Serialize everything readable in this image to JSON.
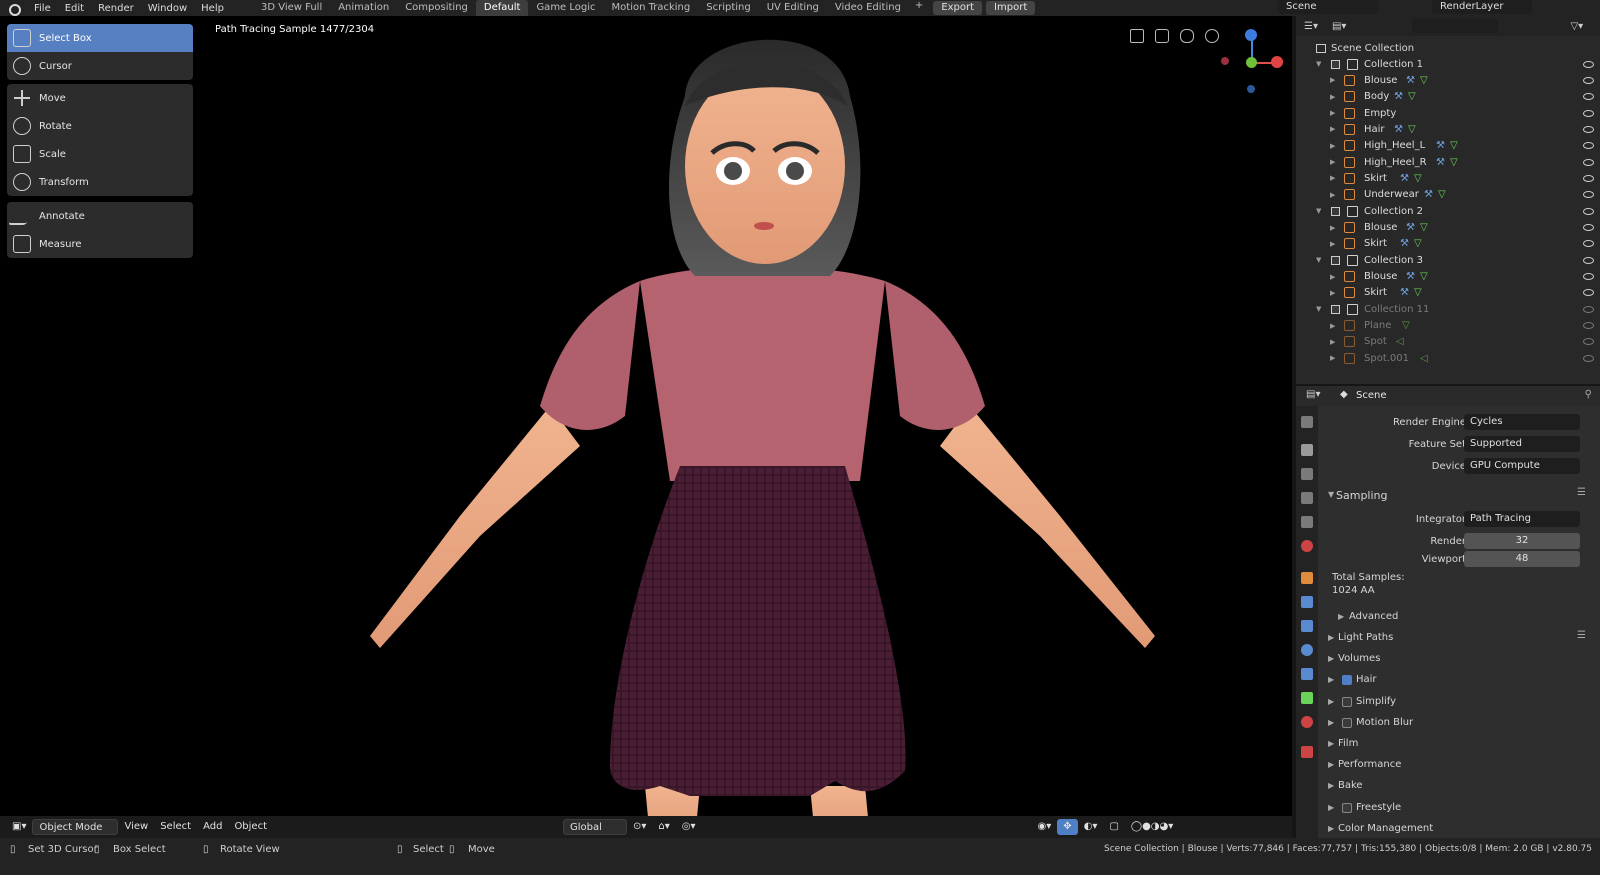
{
  "menu": [
    "File",
    "Edit",
    "Render",
    "Window",
    "Help"
  ],
  "workspace_tabs": [
    "3D View Full",
    "Animation",
    "Compositing",
    "Default",
    "Game Logic",
    "Motion Tracking",
    "Scripting",
    "UV Editing",
    "Video Editing"
  ],
  "active_tab": "Default",
  "top_buttons": {
    "export": "Export",
    "import": "Import"
  },
  "scene_name": "Scene",
  "render_layer": "RenderLayer",
  "tools": [
    {
      "label": "Select Box",
      "icon": "select-box-icon"
    },
    {
      "label": "Cursor",
      "icon": "cursor-icon"
    },
    {
      "label": "Move",
      "icon": "move-icon"
    },
    {
      "label": "Rotate",
      "icon": "rotate-icon"
    },
    {
      "label": "Scale",
      "icon": "scale-icon"
    },
    {
      "label": "Transform",
      "icon": "transform-icon"
    },
    {
      "label": "Annotate",
      "icon": "annotate-icon"
    },
    {
      "label": "Measure",
      "icon": "measure-icon"
    }
  ],
  "viewport": {
    "sample_text": "Path Tracing Sample 1477/2304"
  },
  "header": {
    "mode": "Object Mode",
    "view": "View",
    "select": "Select",
    "add": "Add",
    "object": "Object",
    "orientation": "Global"
  },
  "status": {
    "left1": "Set 3D Cursor",
    "left2": "Box Select",
    "left3": "Rotate View",
    "mid1": "Select",
    "mid2": "Move",
    "right": "Scene Collection | Blouse | Verts:77,846 | Faces:77,757 | Tris:155,380 | Objects:0/8 | Mem: 2.0 GB | v2.80.75"
  },
  "outliner": {
    "root": "Scene Collection",
    "rows": [
      {
        "label": "Collection 1",
        "kind": "collection"
      },
      {
        "label": "Blouse",
        "kind": "mesh"
      },
      {
        "label": "Body",
        "kind": "mesh"
      },
      {
        "label": "Empty",
        "kind": "empty"
      },
      {
        "label": "Hair",
        "kind": "mesh"
      },
      {
        "label": "High_Heel_L",
        "kind": "mesh"
      },
      {
        "label": "High_Heel_R",
        "kind": "mesh"
      },
      {
        "label": "Skirt",
        "kind": "mesh"
      },
      {
        "label": "Underwear",
        "kind": "mesh"
      },
      {
        "label": "Collection 2",
        "kind": "collection"
      },
      {
        "label": "Blouse",
        "kind": "mesh"
      },
      {
        "label": "Skirt",
        "kind": "mesh"
      },
      {
        "label": "Collection 3",
        "kind": "collection"
      },
      {
        "label": "Blouse",
        "kind": "mesh"
      },
      {
        "label": "Skirt",
        "kind": "mesh"
      },
      {
        "label": "Collection 11",
        "kind": "collection-dim"
      },
      {
        "label": "Plane",
        "kind": "dim"
      },
      {
        "label": "Spot",
        "kind": "dim"
      },
      {
        "label": "Spot.001",
        "kind": "dim"
      }
    ]
  },
  "properties": {
    "context": "Scene",
    "render_engine": {
      "label": "Render Engine",
      "value": "Cycles"
    },
    "feature_set": {
      "label": "Feature Set",
      "value": "Supported"
    },
    "device": {
      "label": "Device",
      "value": "GPU Compute"
    },
    "sampling": "Sampling",
    "integrator": {
      "label": "Integrator",
      "value": "Path Tracing"
    },
    "render": {
      "label": "Render",
      "value": "32"
    },
    "viewport": {
      "label": "Viewport",
      "value": "48"
    },
    "total_samples_label": "Total Samples:",
    "total_samples_value": "1024 AA",
    "advanced": "Advanced",
    "sections": [
      {
        "label": "Light Paths",
        "check": null
      },
      {
        "label": "Volumes",
        "check": null
      },
      {
        "label": "Hair",
        "check": true
      },
      {
        "label": "Simplify",
        "check": false
      },
      {
        "label": "Motion Blur",
        "check": false
      },
      {
        "label": "Film",
        "check": null
      },
      {
        "label": "Performance",
        "check": null
      },
      {
        "label": "Bake",
        "check": null
      },
      {
        "label": "Freestyle",
        "check": false
      },
      {
        "label": "Color Management",
        "check": null
      }
    ]
  },
  "colors": {
    "accent": "#5680c2",
    "mesh": "#e08a3c",
    "collection": "#cfcfcf",
    "wrench": "#6fa0e0",
    "tri": "#6cd35a"
  }
}
